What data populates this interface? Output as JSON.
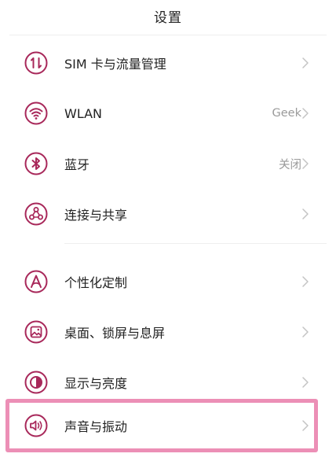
{
  "header": {
    "title": "设置"
  },
  "colors": {
    "icon_accent": "#a8285a",
    "highlight": "#ec8fb6",
    "value_text": "#9a9a9a"
  },
  "items": [
    {
      "label": "SIM 卡与流量管理",
      "value": "",
      "icon": "sim-swap-icon"
    },
    {
      "label": "WLAN",
      "value": "Geek",
      "icon": "wifi-icon"
    },
    {
      "label": "蓝牙",
      "value": "关闭",
      "icon": "bluetooth-icon"
    },
    {
      "label": "连接与共享",
      "value": "",
      "icon": "connection-share-icon"
    },
    {
      "label": "个性化定制",
      "value": "",
      "icon": "personalization-icon"
    },
    {
      "label": "桌面、锁屏与息屏",
      "value": "",
      "icon": "wallpaper-icon"
    },
    {
      "label": "显示与亮度",
      "value": "",
      "icon": "brightness-icon"
    },
    {
      "label": "声音与振动",
      "value": "",
      "icon": "speaker-icon"
    }
  ]
}
